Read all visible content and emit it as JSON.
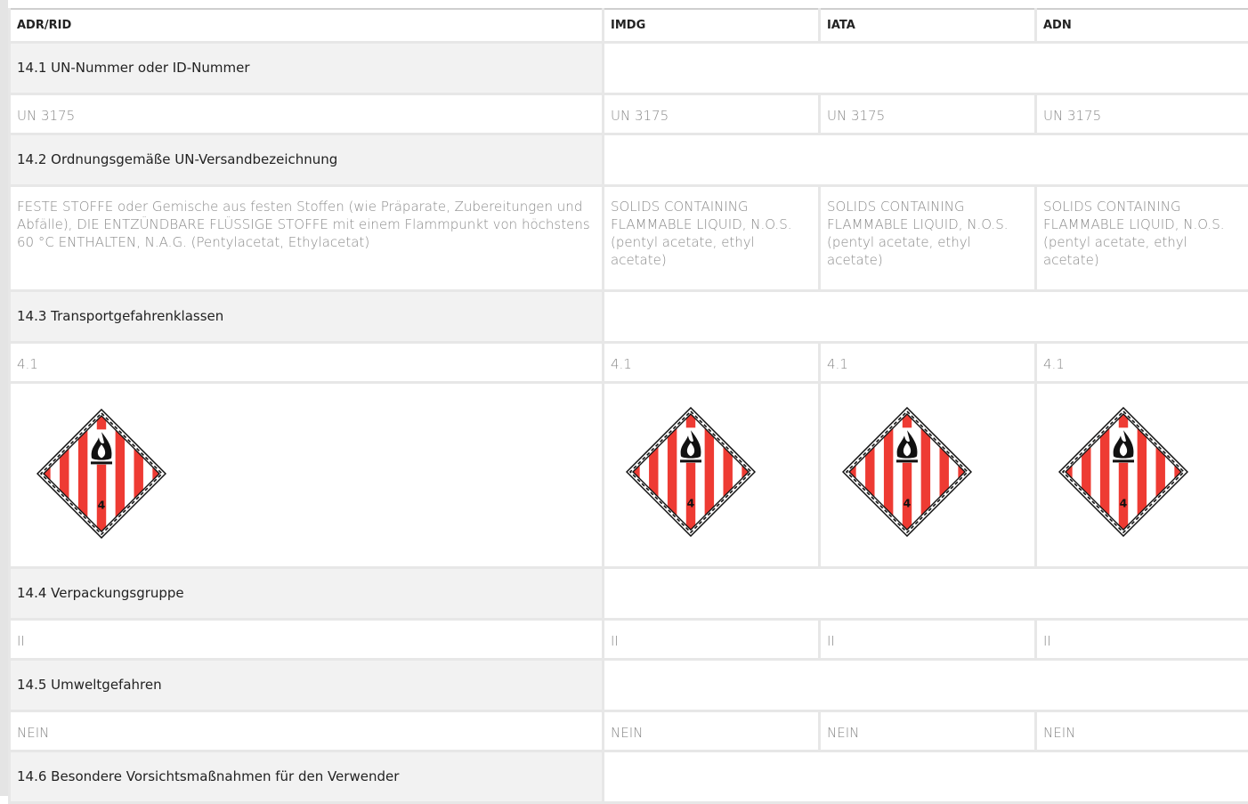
{
  "header": {
    "col1": "ADR/RID",
    "col2": "IMDG",
    "col3": "IATA",
    "col4": "ADN"
  },
  "sections": {
    "s1": {
      "title": "14.1 UN-Nummer oder ID-Nummer",
      "adr": "UN 3175",
      "imdg": "UN 3175",
      "iata": "UN 3175",
      "adn": "UN 3175"
    },
    "s2": {
      "title": "14.2 Ordnungsgemäße UN-Versandbezeichnung",
      "adr": "FESTE STOFFE oder Gemische aus festen Stoffen (wie Präparate, Zubereitungen und Abfälle), DIE ENTZÜNDBARE FLÜSSIGE STOFFE mit einem Flammpunkt von höchstens 60 °C ENTHALTEN, N.A.G. (Pentylacetat, Ethylacetat)",
      "imdg": "SOLIDS CONTAINING FLAMMABLE LIQUID, N.O.S. (pentyl acetate, ethyl acetate)",
      "iata": "SOLIDS CONTAINING FLAMMABLE LIQUID, N.O.S. (pentyl acetate, ethyl acetate)",
      "adn": "SOLIDS CONTAINING FLAMMABLE LIQUID, N.O.S. (pentyl acetate, ethyl acetate)"
    },
    "s3": {
      "title": "14.3 Transportgefahrenklassen",
      "adr": "4.1",
      "imdg": "4.1",
      "iata": "4.1",
      "adn": "4.1",
      "label_number": "4",
      "label_colors": {
        "stripe": "#ee3b33",
        "ground": "#ffffff",
        "symbol": "#111111"
      }
    },
    "s4": {
      "title": "14.4 Verpackungsgruppe",
      "adr": "II",
      "imdg": "II",
      "iata": "II",
      "adn": "II"
    },
    "s5": {
      "title": "14.5 Umweltgefahren",
      "adr": "NEIN",
      "imdg": "NEIN",
      "iata": "NEIN",
      "adn": "NEIN"
    },
    "s6": {
      "title": "14.6 Besondere Vorsichtsmaßnahmen für den Verwender"
    }
  }
}
